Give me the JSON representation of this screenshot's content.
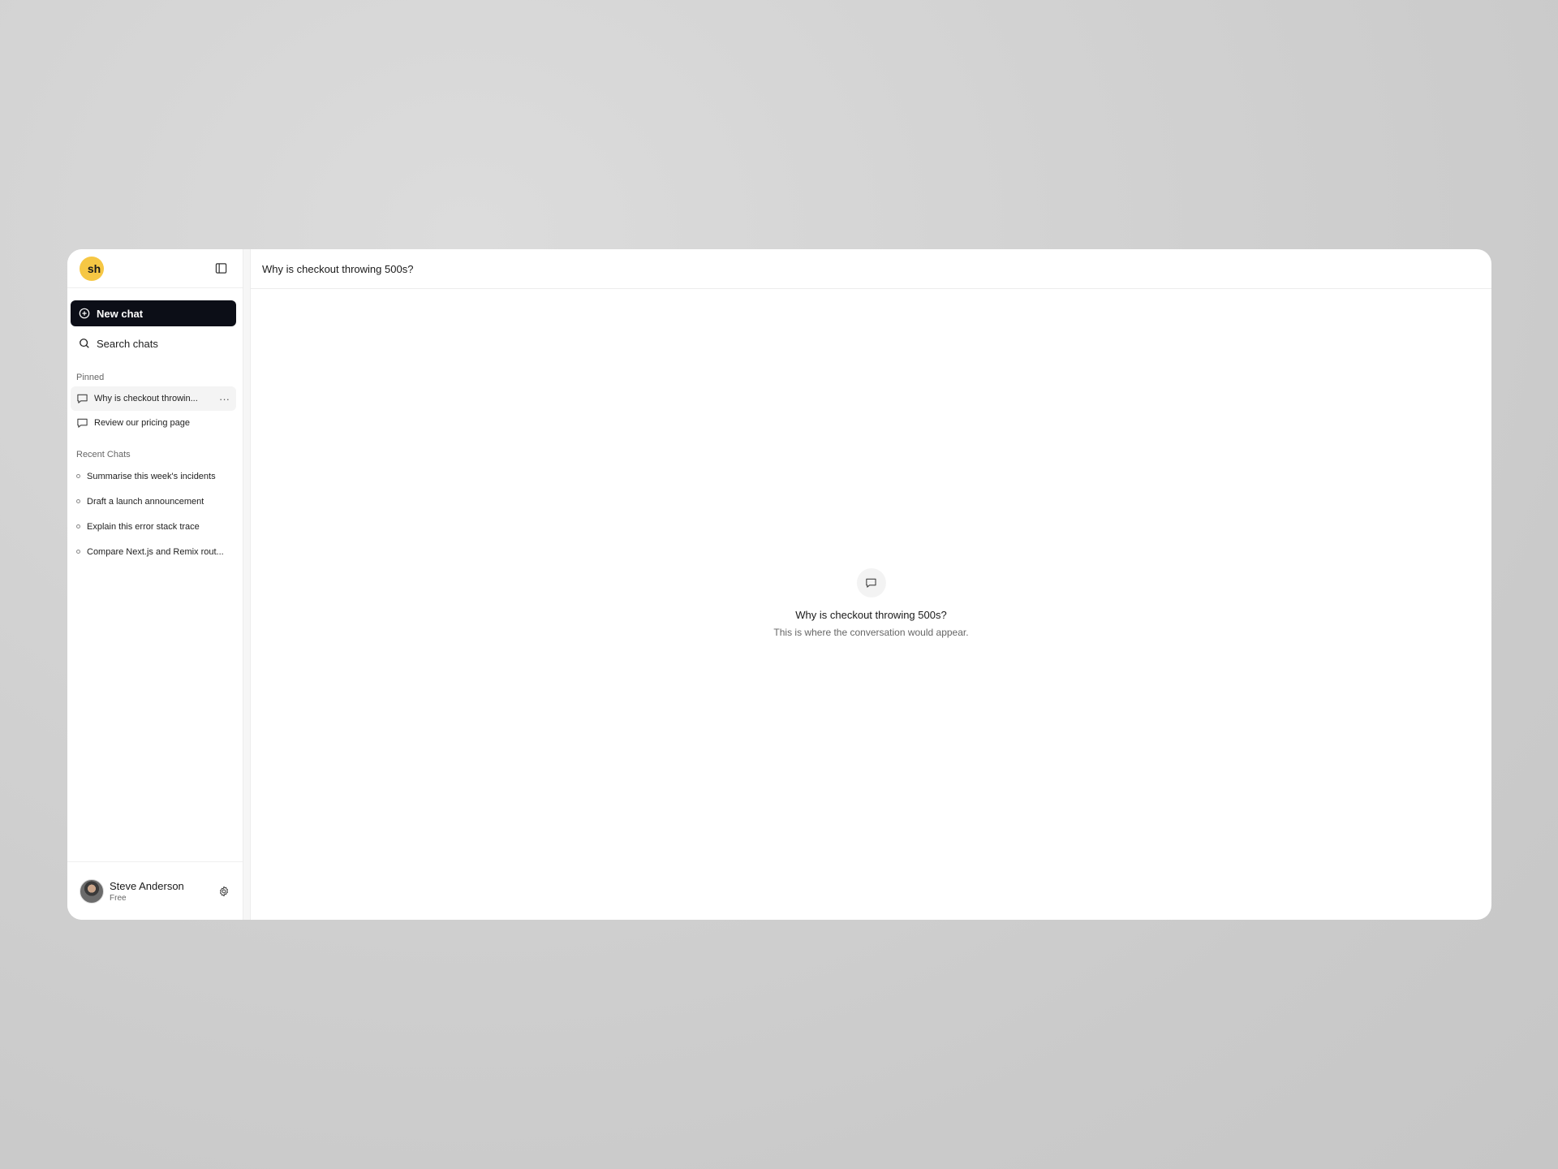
{
  "sidebar": {
    "logo_text": "sh",
    "new_chat_label": "New chat",
    "search_label": "Search chats",
    "pinned_label": "Pinned",
    "pinned": [
      {
        "label": "Why is checkout throwin..."
      },
      {
        "label": "Review our pricing page"
      }
    ],
    "more_label": "···",
    "recent_label": "Recent Chats",
    "recent": [
      {
        "label": "Summarise this week's incidents"
      },
      {
        "label": "Draft a launch announcement"
      },
      {
        "label": "Explain this error stack trace"
      },
      {
        "label": "Compare Next.js and Remix rout..."
      }
    ],
    "user": {
      "name": "Steve Anderson",
      "plan": "Free"
    }
  },
  "main": {
    "title": "Why is checkout throwing 500s?",
    "empty_title": "Why is checkout throwing 500s?",
    "empty_subtitle": "This is where the conversation would appear."
  },
  "colors": {
    "accent_logo": "#f6c744",
    "primary_button": "#0c0e17"
  },
  "icons": {
    "toggle": "sidebar-toggle-icon",
    "new_chat": "plus-circle-icon",
    "search": "search-icon",
    "chat": "chat-bubble-icon",
    "settings": "gear-icon"
  }
}
